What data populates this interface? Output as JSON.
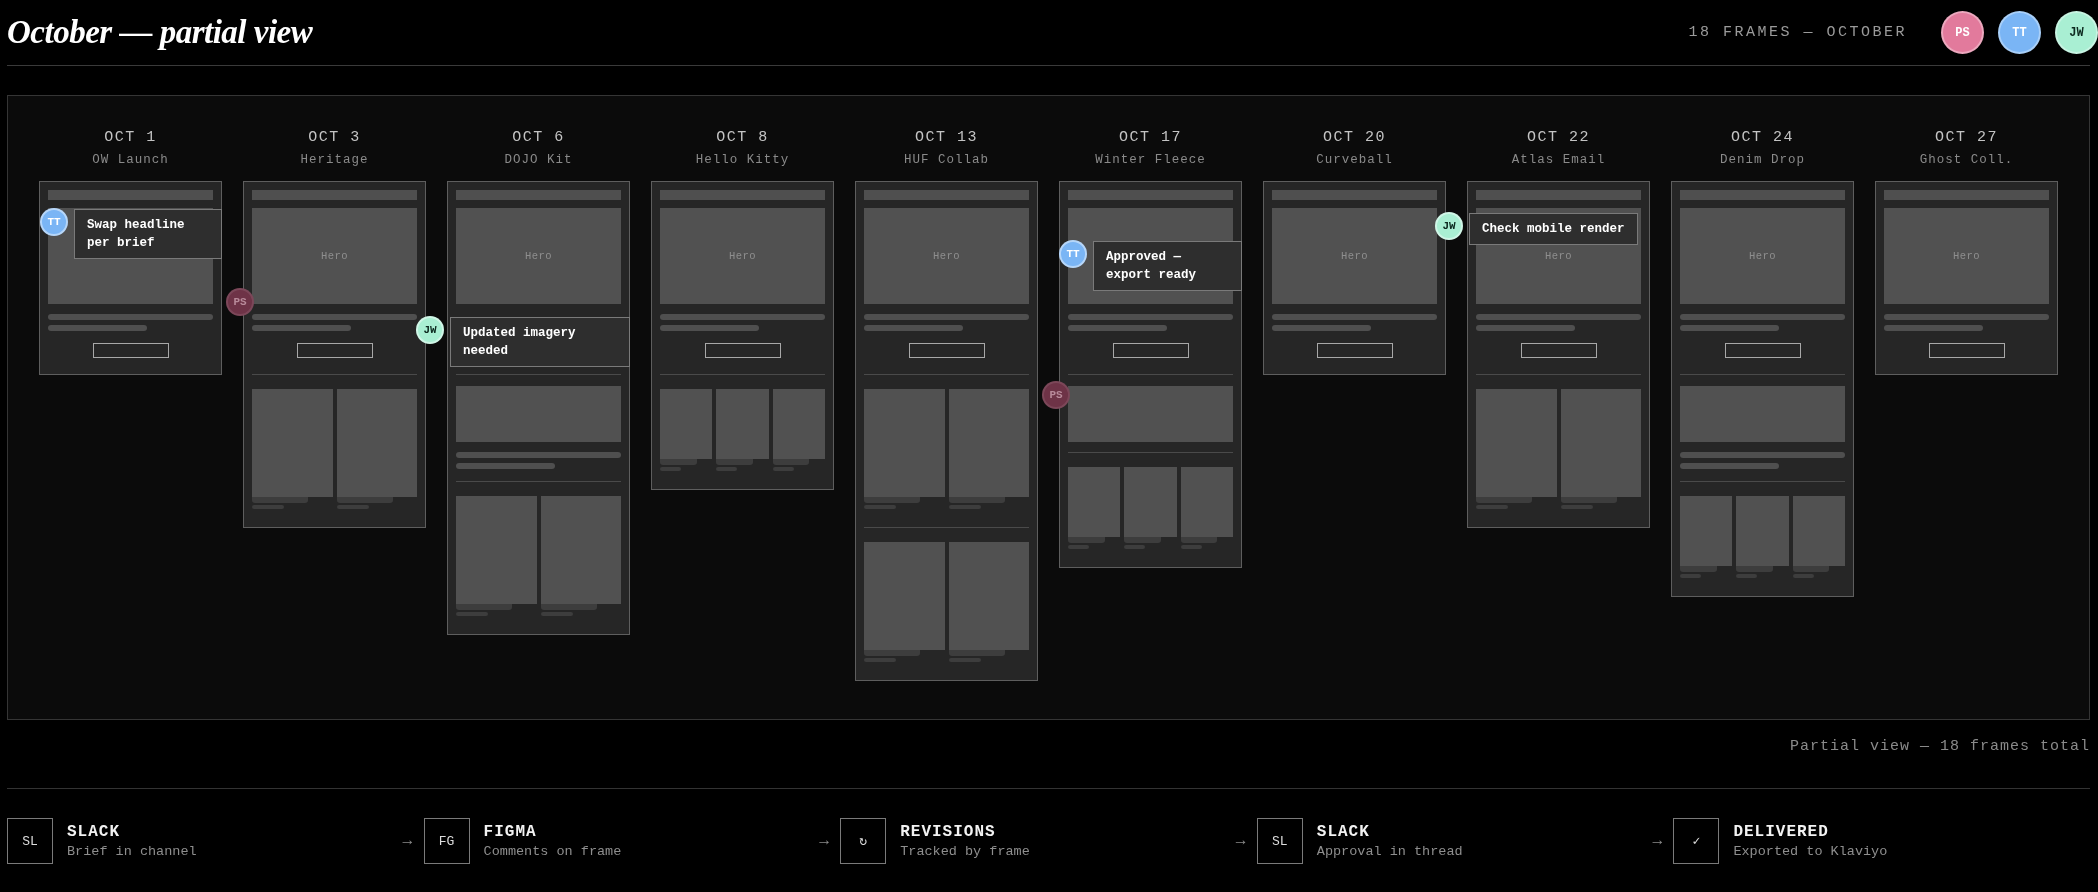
{
  "header": {
    "title": "October — partial view",
    "summary": "18 FRAMES — OCTOBER",
    "people": [
      {
        "initials": "PS",
        "color": "#e27a9c"
      },
      {
        "initials": "TT",
        "color": "#7ab5f5"
      },
      {
        "initials": "JW",
        "color": "#a9efd3"
      }
    ]
  },
  "frames": [
    {
      "date": "OCT 1",
      "name": "OW Launch",
      "comments": [
        {
          "initials": "TT",
          "color": "#7ab5f5",
          "text": "Swap headline per brief",
          "resolved": false
        }
      ]
    },
    {
      "date": "OCT 3",
      "name": "Heritage",
      "hero_label": "Hero",
      "sections": [
        {
          "kind": "grid2"
        }
      ],
      "comments": [
        {
          "initials": "PS",
          "color": "#6e3347",
          "resolved": true
        }
      ]
    },
    {
      "date": "OCT 6",
      "name": "DOJO Kit",
      "hero_label": "Hero",
      "hero_copy_covered": true,
      "sections": [
        {
          "kind": "banner-text"
        },
        {
          "kind": "grid2"
        }
      ],
      "comments": [
        {
          "initials": "JW",
          "color": "#a9efd3",
          "text": "Updated imagery needed",
          "resolved": false
        }
      ]
    },
    {
      "date": "OCT 8",
      "name": "Hello Kitty",
      "hero_label": "Hero",
      "sections": [
        {
          "kind": "grid3"
        }
      ]
    },
    {
      "date": "OCT 13",
      "name": "HUF Collab",
      "hero_label": "Hero",
      "sections": [
        {
          "kind": "grid2"
        },
        {
          "kind": "grid2"
        }
      ]
    },
    {
      "date": "OCT 17",
      "name": "Winter Fleece",
      "sections": [
        {
          "kind": "banner"
        },
        {
          "kind": "grid3"
        }
      ],
      "comments": [
        {
          "initials": "TT",
          "color": "#7ab5f5",
          "text": "Approved — export ready",
          "resolved": false
        },
        {
          "initials": "PS",
          "color": "#6e3347",
          "resolved": true
        }
      ]
    },
    {
      "date": "OCT 20",
      "name": "Curveball",
      "hero_label": "Hero"
    },
    {
      "date": "OCT 22",
      "name": "Atlas Email",
      "hero_label": "Hero",
      "sections": [
        {
          "kind": "grid2"
        }
      ],
      "comments": [
        {
          "initials": "JW",
          "color": "#a9efd3",
          "text": "Check mobile render",
          "resolved": false
        }
      ]
    },
    {
      "date": "OCT 24",
      "name": "Denim Drop",
      "hero_label": "Hero",
      "sections": [
        {
          "kind": "banner-text"
        },
        {
          "kind": "grid3"
        }
      ]
    },
    {
      "date": "OCT 27",
      "name": "Ghost Coll.",
      "hero_label": "Hero"
    }
  ],
  "board_note": "Partial view — 18 frames total",
  "flow": [
    {
      "tile": "SL",
      "title": "SLACK",
      "subtitle": "Brief in channel"
    },
    {
      "arrow": "→",
      "tile": "FG",
      "title": "FIGMA",
      "subtitle": "Comments on frame"
    },
    {
      "arrow": "→",
      "tile": "↻",
      "title": "REVISIONS",
      "subtitle": "Tracked by frame"
    },
    {
      "arrow": "→",
      "tile": "SL",
      "title": "SLACK",
      "subtitle": "Approval in thread"
    },
    {
      "arrow": "→",
      "tile": "✓",
      "title": "DELIVERED",
      "subtitle": "Exported to Klaviyo"
    }
  ]
}
